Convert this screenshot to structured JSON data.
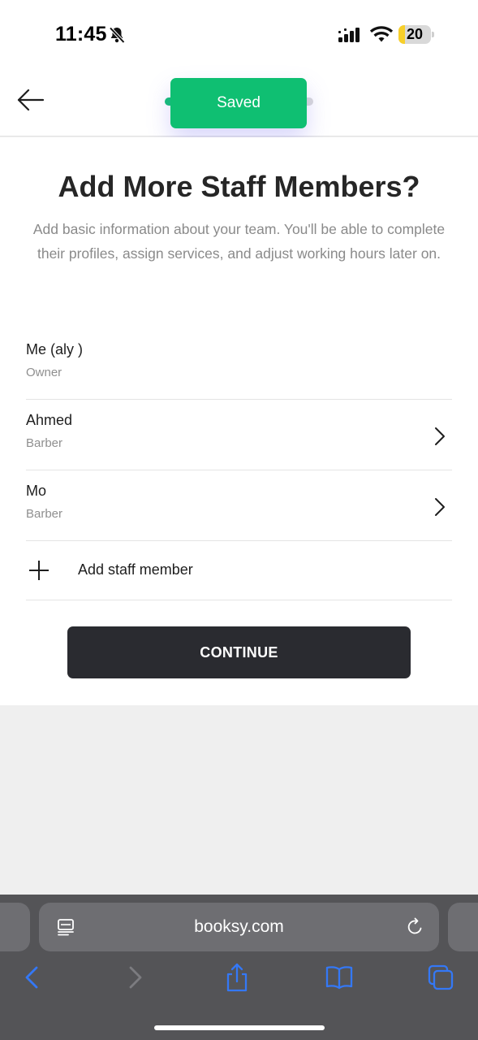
{
  "status_bar": {
    "time": "11:45",
    "battery_level": "20",
    "battery_fraction": 0.2
  },
  "toast": {
    "label": "Saved"
  },
  "page": {
    "title": "Add More Staff Members?",
    "subtitle": "Add basic information about your team. You'll be able to complete their profiles, assign services, and adjust working hours later on."
  },
  "staff": [
    {
      "name": "Me (aly )",
      "role": "Owner",
      "has_chevron": false
    },
    {
      "name": "Ahmed",
      "role": "Barber",
      "has_chevron": true
    },
    {
      "name": "Mo",
      "role": "Barber",
      "has_chevron": true
    }
  ],
  "add_staff": {
    "label": "Add staff member"
  },
  "continue_button": {
    "label": "CONTINUE"
  },
  "browser": {
    "url": "booksy.com"
  },
  "colors": {
    "accent_green": "#0fbf72",
    "button_dark": "#2a2b30",
    "ios_blue": "#3478f6"
  },
  "icons": [
    "bell-slash-icon",
    "cellular-signal-icon",
    "wifi-icon",
    "battery-icon",
    "back-arrow-icon",
    "chevron-right-icon",
    "plus-icon",
    "reader-mode-icon",
    "reload-icon",
    "browser-back-icon",
    "browser-forward-icon",
    "share-icon",
    "bookmarks-icon",
    "tabs-icon"
  ]
}
